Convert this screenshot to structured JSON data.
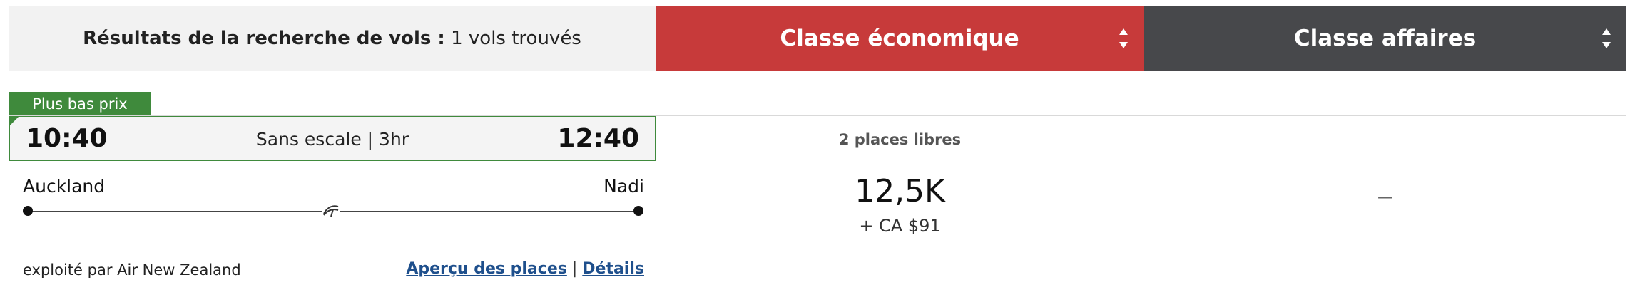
{
  "header": {
    "results_label": "Résultats de la recherche de vols :",
    "results_count": "1 vols trouvés",
    "economy_tab": "Classe économique",
    "business_tab": "Classe affaires"
  },
  "flight": {
    "badge": "Plus bas prix",
    "departure_time": "10:40",
    "arrival_time": "12:40",
    "route_info": "Sans escale | 3hr",
    "origin": "Auckland",
    "destination": "Nadi",
    "operator": "exploité par Air New Zealand",
    "seats_preview_link": "Aperçu des places",
    "link_separator": "|",
    "details_link": "Détails",
    "icon": "airline-logo-icon"
  },
  "economy": {
    "seats": "2 places libres",
    "points": "12,5K",
    "cash": "+ CA $91"
  },
  "business": {
    "value": "—"
  },
  "colors": {
    "economy_header": "#c73a3a",
    "business_header": "#47484b",
    "badge": "#3f8a3c",
    "link": "#1e4f8c"
  }
}
